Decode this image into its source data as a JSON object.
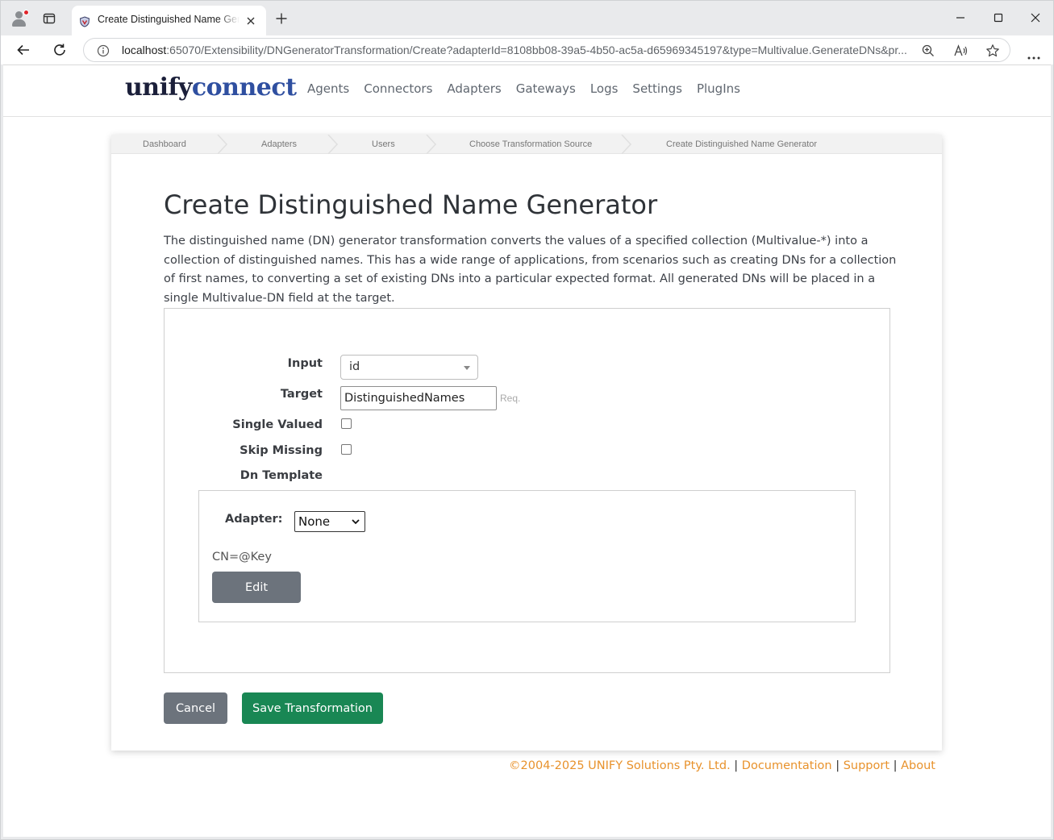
{
  "browser": {
    "tab_title": "Create Distinguished Name Generator",
    "url_host": "localhost",
    "url_rest": ":65070/Extensibility/DNGeneratorTransformation/Create?adapterId=8108bb08-39a5-4b50-ac5a-d65969345197&type=Multivalue.GenerateDNs&pr..."
  },
  "header": {
    "logo_part1": "unify",
    "logo_part2": "connect",
    "nav": [
      "Agents",
      "Connectors",
      "Adapters",
      "Gateways",
      "Logs",
      "Settings",
      "PlugIns"
    ]
  },
  "breadcrumbs": [
    "Dashboard",
    "Adapters",
    "Users",
    "Choose Transformation Source",
    "Create Distinguished Name Generator"
  ],
  "page": {
    "title": "Create Distinguished Name Generator",
    "description": "The distinguished name (DN) generator transformation converts the values of a specified collection (Multivalue-*) into a collection of distinguished names. This has a wide range of applications, from scenarios such as creating DNs for a collection of first names, to converting a set of existing DNs into a particular expected format. All generated DNs will be placed in a single Multivalue-DN field at the target."
  },
  "form": {
    "input_label": "Input",
    "input_value": "id",
    "target_label": "Target",
    "target_value": "DistinguishedNames",
    "target_required": "Req.",
    "single_valued_label": "Single Valued",
    "single_valued_checked": false,
    "skip_missing_label": "Skip Missing",
    "skip_missing_checked": false,
    "dn_template_label": "Dn Template",
    "adapter_label": "Adapter:",
    "adapter_value": "None",
    "dn_template_value": "CN=@Key",
    "edit_button": "Edit"
  },
  "actions": {
    "cancel": "Cancel",
    "save": "Save Transformation"
  },
  "footer": {
    "copyright": "©2004-2025 UNIFY Solutions Pty. Ltd.",
    "documentation": "Documentation",
    "support": "Support",
    "about": "About",
    "separator": "|"
  },
  "colors": {
    "save_button": "#198754",
    "neutral_button": "#6c737c",
    "footer_link": "#e8922c",
    "logo_dark": "#1b1f3a",
    "logo_blue": "#2f4fa0"
  }
}
